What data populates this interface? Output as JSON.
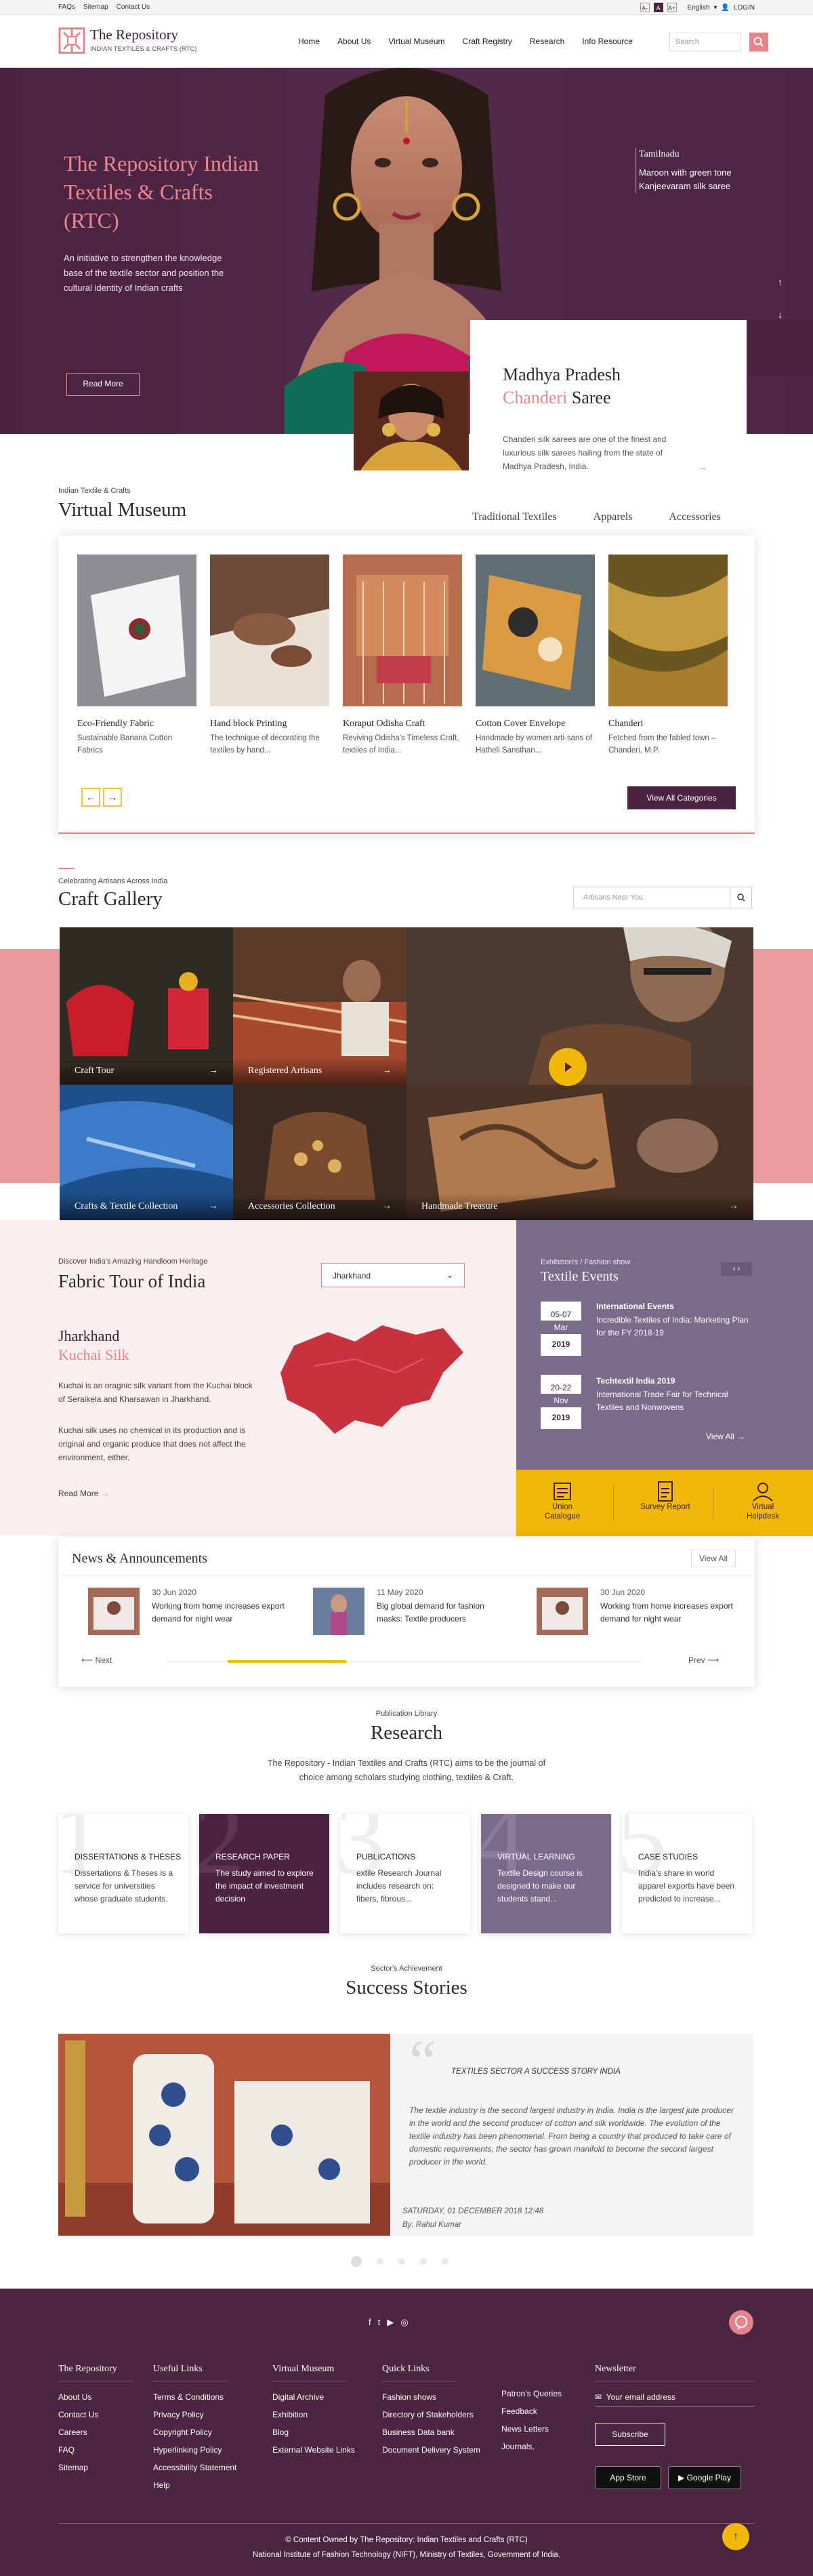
{
  "topbar": {
    "links": [
      "FAQs",
      "Sitemap",
      "Contact Us"
    ],
    "font_sizes": [
      "A-",
      "A",
      "A+"
    ],
    "language": "English",
    "login": "LOGIN"
  },
  "header": {
    "brand_title": "The Repository",
    "brand_subtitle": "INDIAN TEXTILES & CRAFTS (RTC)",
    "nav": [
      "Home",
      "About Us",
      "Virtual Museum",
      "Craft Registry",
      "Research",
      "Info Resource"
    ],
    "search_placeholder": "Search"
  },
  "hero": {
    "title": "The Repository Indian Textiles & Crafts (RTC)",
    "text": "An initiative to strengthen the knowledge base of the textile sector and position the cultural identity of Indian crafts",
    "button": "Read More",
    "side_heading": "Tamilnadu",
    "side_text": "Maroon with green tone Kanjeevaram silk saree",
    "card_state": "Madhya Pradesh",
    "card_title_accent": "Chanderi",
    "card_title_rest": "Saree",
    "card_text": "Chanderi silk sarees are one of the finest and luxurious silk sarees hailing from the state of Madhya Pradesh, India."
  },
  "museum": {
    "label": "Indian Textile & Crafts",
    "title": "Virtual Museum",
    "tabs": [
      "Traditional Textiles",
      "Apparels",
      "Accessories"
    ],
    "items": [
      {
        "title": "Eco-Friendly Fabric",
        "desc": "Sustainable Banana Cotton Fabrics"
      },
      {
        "title": "Hand block Printing",
        "desc": "The technique of decorating the textiles by hand..."
      },
      {
        "title": "Koraput Odisha Craft",
        "desc": "Reviving Odisha's Timeless Craft, textiles of India..."
      },
      {
        "title": "Cotton Cover Envelope",
        "desc": "Handmade by women arti-sans of Hatheli Sansthan..."
      },
      {
        "title": "Chanderi",
        "desc": "Fetched from the fabled town – Chanderi, M.P."
      }
    ],
    "view_all": "View All Categories"
  },
  "gallery": {
    "label": "Celebrating Artisans Across India",
    "title": "Craft  Gallery",
    "search_placeholder": "Artisans Near You",
    "tiles": [
      "Craft Tour",
      "Registered Artisans",
      "Crafts & Textile Collection",
      "Accessories Collection",
      "Handmade Treasure"
    ]
  },
  "fabric_tour": {
    "label": "Discover India's Amazing Handloom Heritage",
    "title": "Fabric Tour of India",
    "state_selected": "Jharkhand",
    "heading": "Jharkhand",
    "subheading": "Kuchai Silk",
    "para1": "Kuchai is an oragnic silk variant from the Kuchai block of Seraikela and Kharsawan in Jharkhand.",
    "para2": "Kuchai silk uses no chemical in its production and is original and organic produce that does not affect the environment, either.",
    "read_more": "Read More"
  },
  "events": {
    "label": "Exhibition's / Fashion show",
    "title": "Textile Events",
    "items": [
      {
        "day": "05-07",
        "month": "Mar",
        "year": "2019",
        "title": "International Events",
        "desc": "Incredible Textiles of India: Marketing Plan for the FY 2018-19"
      },
      {
        "day": "20-22",
        "month": "Nov",
        "year": "2019",
        "title": "Techtextil India 2019",
        "desc": "International Trade Fair for Technical Textiles and Nonwovens"
      }
    ],
    "view_all": "View All"
  },
  "quick_links": [
    "Union Catalogue",
    "Survey Report",
    "Virtual Helpdesk"
  ],
  "news": {
    "title": "News & Announcements",
    "view_all": "View All",
    "items": [
      {
        "date": "30 Jun 2020",
        "text": "Working from home increases export demand for night wear"
      },
      {
        "date": "11 May 2020",
        "text": "Big global demand for fashion masks: Textile producers"
      },
      {
        "date": "30 Jun 2020",
        "text": "Working from home increases export demand for night wear"
      }
    ],
    "next": "Next",
    "prev": "Prev",
    "progress": 0.25
  },
  "research": {
    "label": "Publication Library",
    "title": "Research",
    "intro": "The Repository - Indian Textiles and Crafts (RTC) aims to be the journal of choice among scholars studying clothing, textiles & Craft.",
    "cards": [
      {
        "num": "1",
        "title": "DISSERTATIONS & THESES",
        "text": "Dissertations & Theses is a service for universities whose graduate students."
      },
      {
        "num": "2",
        "title": "RESEARCH PAPER",
        "text": "The study aimed to explore the impact of investment decision"
      },
      {
        "num": "3",
        "title": "PUBLICATIONS",
        "text": "extile Research Journal includes research on: fibers, fibrous..."
      },
      {
        "num": "4",
        "title": "VIRTUAL LEARNING",
        "text": "Textile Design course is designed to make our students stand..."
      },
      {
        "num": "5",
        "title": "CASE STUDIES",
        "text": "India's share in world apparel exports have been predicted to increase..."
      }
    ]
  },
  "success": {
    "label": "Sector's Achievement",
    "title": "Success Stories",
    "quote_heading": "TEXTILES SECTOR A SUCCESS STORY INDIA",
    "quote": "The textile industry is the second largest industry in India. India is the largest jute producer in the world and the second producer of cotton and silk worldwide. The evolution of the textile industry has been phenomenal. From being a country that produced to take care of domestic requirements, the sector has grown manifold to become the second largest producer in the world.",
    "date": "SATURDAY, 01 DECEMBER 2018 12:48",
    "author": "By: Rahul Kumar",
    "dots": 5
  },
  "footer": {
    "columns": [
      {
        "heading": "The Repository",
        "links": [
          "About Us",
          "Contact Us",
          "Careers",
          "FAQ",
          "Sitemap"
        ]
      },
      {
        "heading": "Useful Links",
        "links": [
          "Terms & Conditions",
          "Privacy Policy",
          "Copyright Policy",
          "Hyperlinking Policy",
          "Accessibility Statement",
          "Help"
        ]
      },
      {
        "heading": "Virtual Museum",
        "links": [
          "Digital Archive",
          "Exhibition",
          "Blog",
          "External Website Links"
        ]
      },
      {
        "heading": "Quick Links",
        "links": [
          "Fashion shows",
          "Directory of Stakeholders",
          "Business Data bank",
          "Document Delivery System"
        ]
      },
      {
        "heading": "",
        "links": [
          "Patron's Queries",
          "Feedback",
          "News Letters",
          "Journals,"
        ]
      }
    ],
    "newsletter_heading": "Newsletter",
    "email_placeholder": "Your email address",
    "subscribe": "Subscribe",
    "app_store": "App Store",
    "google_play": "Google Play",
    "copyright1": "© Content Owned by The Repository: Indian Textiles and Crafts (RTC)",
    "copyright2": "National Institute of Fashion Technology (NIFT), Ministry of Textiles, Government of India."
  },
  "colors": {
    "brand": "#4b2341",
    "accent": "#e4848a",
    "yellow": "#f2b807",
    "lavender": "#7a6b8a"
  }
}
